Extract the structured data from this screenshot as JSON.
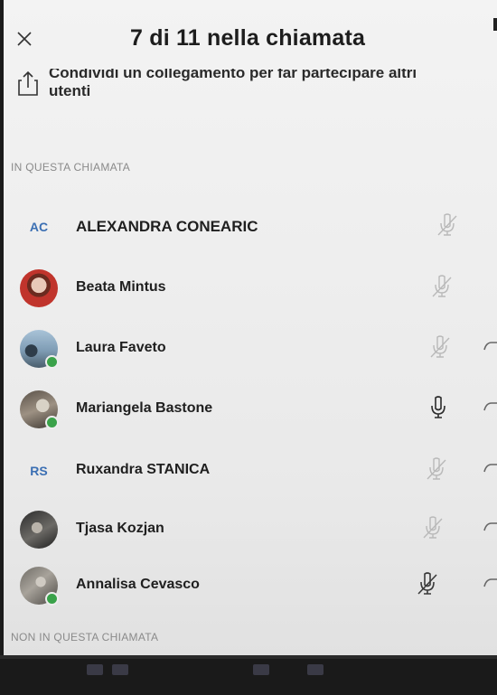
{
  "header": {
    "close_icon": "close-icon",
    "title": "7 di 11 nella chiamata"
  },
  "share": {
    "icon": "share-icon",
    "line1": "Condividi un collegamento per far partecipare altri",
    "line2": "utenti"
  },
  "sections": {
    "in_call": "IN QUESTA CHIAMATA",
    "not_in_call": "NON IN QUESTA CHIAMATA"
  },
  "participants": [
    {
      "name": "ALEXANDRA CONEARIC",
      "initials": "AC",
      "avatar": "initials",
      "online": false,
      "mic": "muted"
    },
    {
      "name": "Beata Mintus",
      "initials": "",
      "avatar": "photo-red",
      "online": false,
      "mic": "muted"
    },
    {
      "name": "Laura Faveto",
      "initials": "",
      "avatar": "photo-blue",
      "online": true,
      "mic": "muted"
    },
    {
      "name": "Mariangela Bastone",
      "initials": "",
      "avatar": "photo-gray",
      "online": true,
      "mic": "on"
    },
    {
      "name": "Ruxandra STANICA",
      "initials": "RS",
      "avatar": "initials",
      "online": false,
      "mic": "muted"
    },
    {
      "name": "Tjasa Kozjan",
      "initials": "",
      "avatar": "photo-dark",
      "online": false,
      "mic": "muted"
    },
    {
      "name": "Annalisa Cevasco",
      "initials": "",
      "avatar": "photo-gray2",
      "online": true,
      "mic": "muted-dark"
    }
  ],
  "colors": {
    "background": "#eeeeee",
    "initials_text": "#3b6fb3",
    "presence_online": "#3aa24a",
    "text_primary": "#1f1f1f",
    "section_label": "#8a8a8a"
  }
}
